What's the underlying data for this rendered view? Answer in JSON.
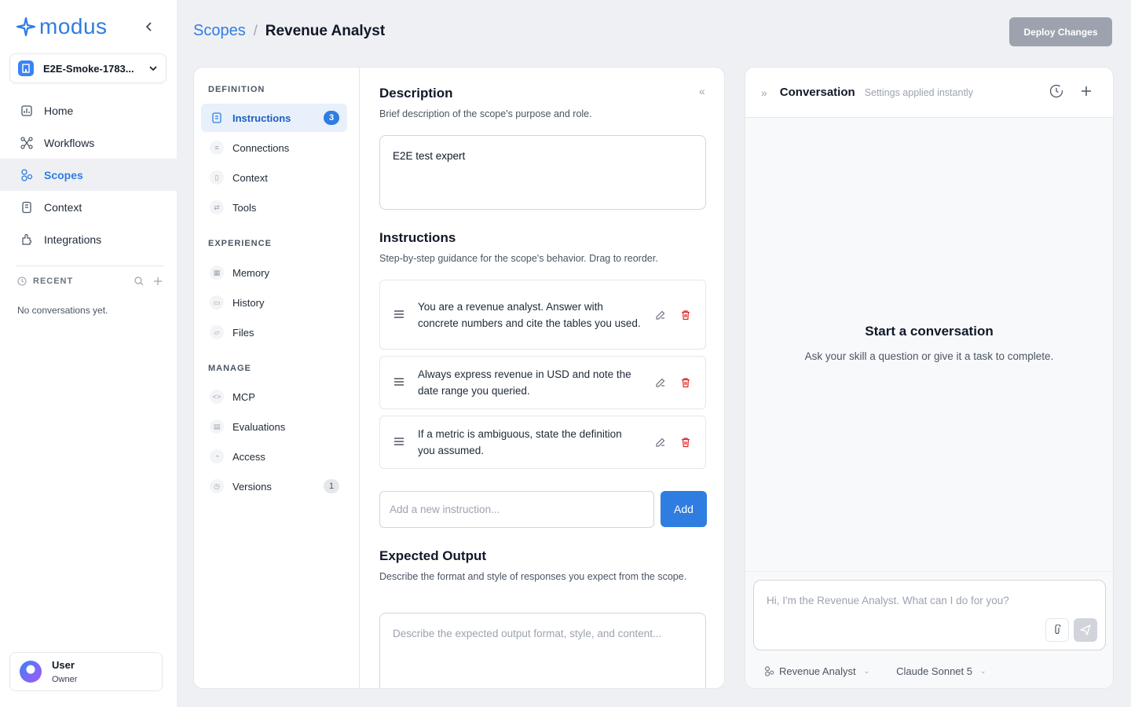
{
  "app": {
    "logo": "modus",
    "workspace": "E2E-Smoke-1783...",
    "nav": [
      {
        "label": "Home",
        "icon": "home-icon",
        "active": false
      },
      {
        "label": "Workflows",
        "icon": "workflows-icon",
        "active": false
      },
      {
        "label": "Scopes",
        "icon": "scopes-icon",
        "active": true
      },
      {
        "label": "Context",
        "icon": "context-icon",
        "active": false
      },
      {
        "label": "Integrations",
        "icon": "integrations-icon",
        "active": false
      }
    ],
    "recent_label": "RECENT",
    "recent_empty": "No conversations yet.",
    "user": {
      "name": "User",
      "role": "Owner"
    }
  },
  "header": {
    "breadcrumb_parent": "Scopes",
    "breadcrumb_sep": "/",
    "breadcrumb_current": "Revenue Analyst",
    "deploy_label": "Deploy Changes"
  },
  "scope_nav": {
    "definition_label": "DEFINITION",
    "experience_label": "EXPERIENCE",
    "manage_label": "MANAGE",
    "definition": [
      {
        "label": "Instructions",
        "badge": "3",
        "active": true
      },
      {
        "label": "Connections"
      },
      {
        "label": "Context"
      },
      {
        "label": "Tools"
      }
    ],
    "experience": [
      {
        "label": "Memory"
      },
      {
        "label": "History"
      },
      {
        "label": "Files"
      }
    ],
    "manage": [
      {
        "label": "MCP"
      },
      {
        "label": "Evaluations"
      },
      {
        "label": "Access"
      },
      {
        "label": "Versions",
        "badge": "1"
      }
    ]
  },
  "editor": {
    "description_title": "Description",
    "description_sub": "Brief description of the scope's purpose and role.",
    "description_value": "E2E test expert",
    "instructions_title": "Instructions",
    "instructions_sub": "Step-by-step guidance for the scope's behavior. Drag to reorder.",
    "instructions": [
      "You are a revenue analyst. Answer with concrete numbers and cite the tables you used.",
      "Always express revenue in USD and note the date range you queried.",
      "If a metric is ambiguous, state the definition you assumed."
    ],
    "new_instruction_placeholder": "Add a new instruction...",
    "add_label": "Add",
    "expected_title": "Expected Output",
    "expected_sub": "Describe the format and style of responses you expect from the scope.",
    "expected_placeholder": "Describe the expected output format, style, and content..."
  },
  "conversation": {
    "title": "Conversation",
    "subtitle": "Settings applied instantly",
    "empty_title": "Start a conversation",
    "empty_sub": "Ask your skill a question or give it a task to complete.",
    "input_placeholder": "Hi, I'm the Revenue Analyst. What can I do for you?",
    "scope_select": "Revenue Analyst",
    "model_select": "Claude Sonnet 5"
  },
  "colors": {
    "accent": "#2f7de1",
    "delete": "#dc2626",
    "deploy_disabled": "#9ca3af"
  }
}
